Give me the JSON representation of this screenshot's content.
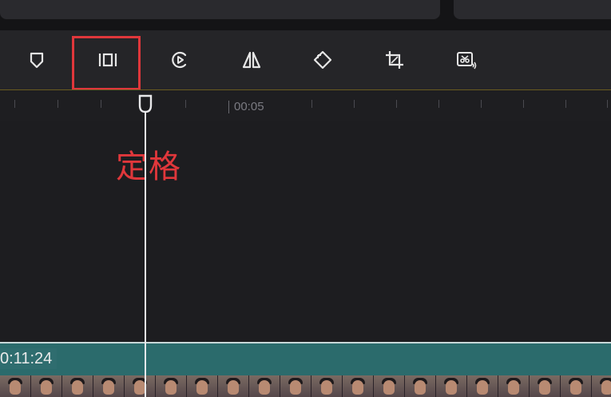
{
  "toolbar": {
    "tools": [
      {
        "id": "mark",
        "icon": "shield-marker-icon"
      },
      {
        "id": "freeze",
        "icon": "freeze-frame-icon"
      },
      {
        "id": "speed",
        "icon": "speed-play-icon"
      },
      {
        "id": "mirror",
        "icon": "mirror-icon"
      },
      {
        "id": "rotate",
        "icon": "rotate-icon"
      },
      {
        "id": "crop",
        "icon": "crop-icon"
      },
      {
        "id": "voice",
        "icon": "audio-cut-icon"
      }
    ],
    "highlighted_tool": "freeze"
  },
  "ruler": {
    "label": "00:05"
  },
  "annotation": {
    "text": "定格",
    "color": "#e0373b"
  },
  "clip": {
    "time": "0:11:24"
  },
  "colors": {
    "accent_red": "#e0373b",
    "clip_teal": "#2b6b6c",
    "playhead": "#e8e8ea"
  }
}
